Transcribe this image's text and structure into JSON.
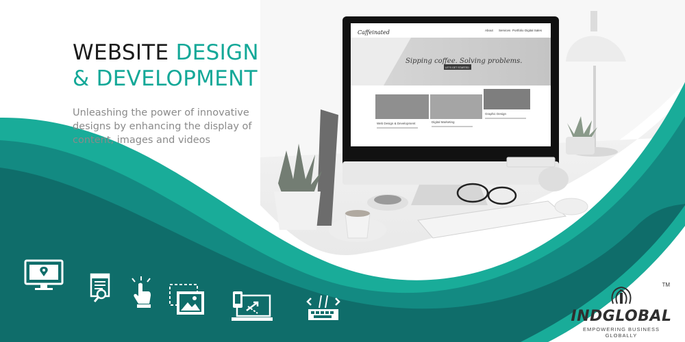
{
  "headline": {
    "line1_dark": "WEBSITE ",
    "line1_teal": "DESIGN",
    "line2_teal": "& DEVELOPMENT"
  },
  "tagline": "Unleashing the power of innovative designs by enhancing the display of content, images and videos",
  "monitor_screen": {
    "site_logo": "Caffeinated",
    "nav_items": [
      "About",
      "Services",
      "Portfolio",
      "Digital Sales"
    ],
    "hero_text": "Sipping coffee. Solving problems.",
    "hero_button": "LETS GET STARTED",
    "card_titles": [
      "Web Design & Development",
      "Digital Marketing",
      "Graphic Design"
    ]
  },
  "feature_icons": [
    "location-monitor-icon",
    "web-document-search-icon",
    "touch-tap-icon",
    "image-crop-icon",
    "responsive-devices-icon",
    "code-keyboard-icon"
  ],
  "brand": {
    "name": "INDGLOBAL",
    "trademark": "TM",
    "tagline": "EMPOWERING BUSINESS GLOBALLY",
    "logo_icon": "globe-logo-icon"
  },
  "colors": {
    "teal_dark": "#0f6d6a",
    "teal_mid": "#138a82",
    "teal_light": "#19ac99",
    "headline_dark": "#1b1b1b",
    "tagline_gray": "#8a8a8a"
  }
}
